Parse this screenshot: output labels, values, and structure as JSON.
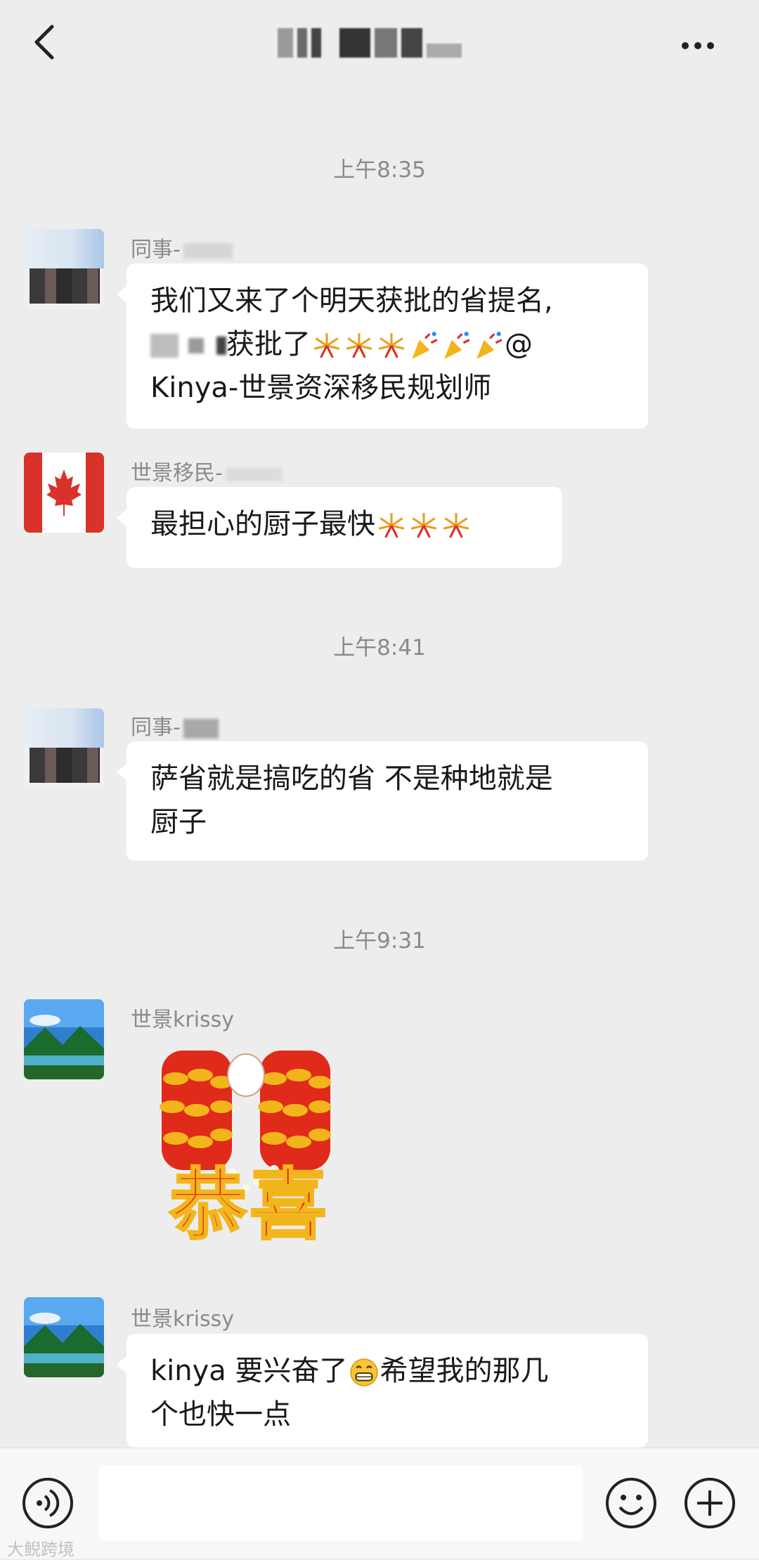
{
  "header": {
    "title_blurred": true,
    "back_icon": "chevron-left-icon",
    "more_icon": "more-dots-icon"
  },
  "timestamps": [
    "上午8:35",
    "上午8:41",
    "上午9:31"
  ],
  "messages": [
    {
      "sender": "同事-",
      "line1": "我们又来了个明天获批的省提名,",
      "line2_text": "获批了",
      "line2_suffix": "@",
      "line3": "Kinya-世景资深移民规划师"
    },
    {
      "sender": "世景移民-",
      "text": "最担心的厨子最快"
    },
    {
      "sender": "同事-",
      "line1": "萨省就是搞吃的省 不是种地就是",
      "line2": "厨子"
    },
    {
      "sender": "世景krissy",
      "sticker_text": "恭喜"
    },
    {
      "sender": "世景krissy",
      "line1_a": "kinya 要兴奋了",
      "line1_b": "希望我的那几",
      "line2": "个也快一点"
    }
  ],
  "colors": {
    "background": "#ededed",
    "bubble": "#ffffff",
    "timestamp": "#8a8a8a",
    "sticker_red": "#e02a1a",
    "sticker_gold": "#f2b51c"
  },
  "watermark": "大鲵跨境"
}
